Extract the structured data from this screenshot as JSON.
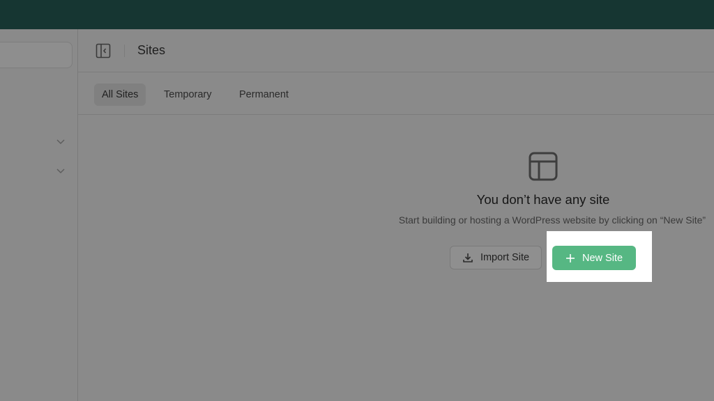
{
  "header": {
    "title": "Sites"
  },
  "tabs": [
    {
      "label": "All Sites",
      "active": true
    },
    {
      "label": "Temporary",
      "active": false
    },
    {
      "label": "Permanent",
      "active": false
    }
  ],
  "empty_state": {
    "icon": "layout-icon",
    "title": "You don’t have any site",
    "subtitle": "Start building or hosting a WordPress website by clicking on “New Site”"
  },
  "actions": {
    "import_label": "Import Site",
    "new_label": "New Site"
  },
  "colors": {
    "topbar": "#163632",
    "primary": "#56b783"
  }
}
